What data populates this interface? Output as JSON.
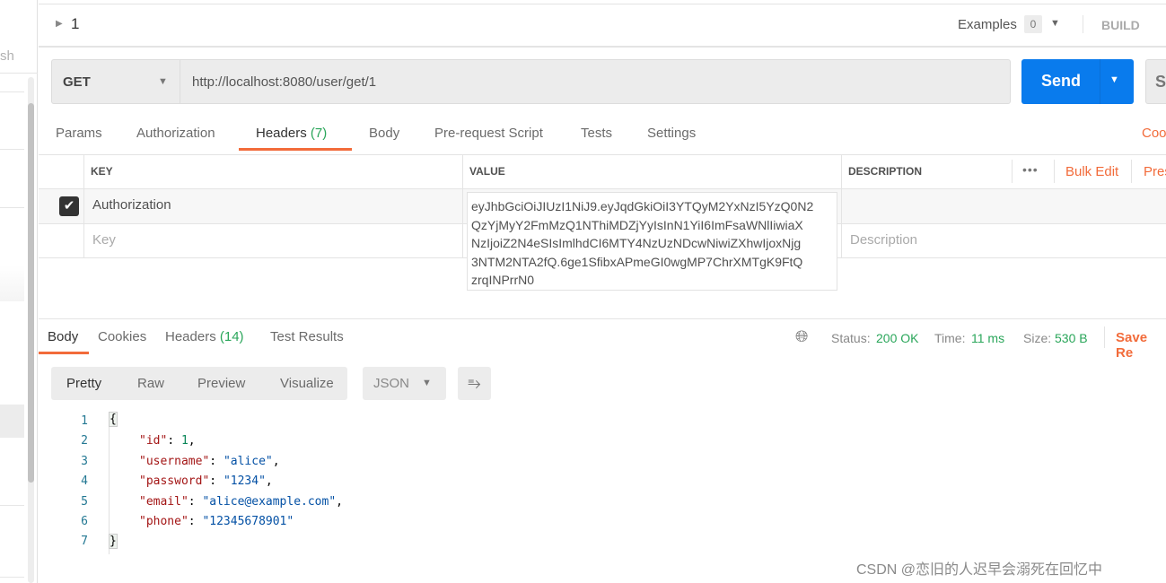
{
  "sidebar": {
    "partial_label": "sh"
  },
  "request": {
    "name": "1",
    "examples_label": "Examples",
    "examples_count": "0",
    "build_label": "BUILD",
    "method": "GET",
    "url": "http://localhost:8080/user/get/1",
    "send_label": "Send",
    "save_label": "Sa",
    "tabs": [
      {
        "label": "Params"
      },
      {
        "label": "Authorization"
      },
      {
        "label": "Headers",
        "count": "(7)"
      },
      {
        "label": "Body"
      },
      {
        "label": "Pre-request Script"
      },
      {
        "label": "Tests"
      },
      {
        "label": "Settings"
      }
    ],
    "cookies_link": "Coo",
    "active_tab": "Headers"
  },
  "headers_table": {
    "columns": {
      "key": "KEY",
      "value": "VALUE",
      "description": "DESCRIPTION"
    },
    "more_label": "•••",
    "bulk_edit": "Bulk Edit",
    "presets": "Pres",
    "rows": [
      {
        "checked": true,
        "key": "Authorization",
        "value": "eyJhbGciOiJIUzI1NiJ9.eyJqdGkiOiI3YTQyM2YxNzI5YzQ0N2QzYjMyY2FmMzQ1NThiMDZjYyIsInN1YiI6ImFsaWNlIiwiaXNzIjoiZ2N4eSIsImlhdCI6MTY4NzUzNDcwNiwiZXhwIjoxNjg3NTM2NTA2fQ.6ge1SfibxAPmeGI0wgMP7ChrXMTgK9FtQzrqINPrrN0"
      }
    ],
    "placeholder": {
      "key": "Key",
      "description": "Description"
    },
    "value_popup_lines": [
      "eyJhbGciOiJIUzI1NiJ9.eyJqdGkiOiI3YTQyM2YxNzI5YzQ0N2",
      "QzYjMyY2FmMzQ1NThiMDZjYyIsInN1YiI6ImFsaWNlIiwiaX",
      "NzIjoiZ2N4eSIsImlhdCI6MTY4NzUzNDcwNiwiZXhwIjoxNjg",
      "3NTM2NTA2fQ.6ge1SfibxAPmeGI0wgMP7ChrXMTgK9FtQ",
      "zrqINPrrN0"
    ]
  },
  "response": {
    "tabs": [
      {
        "label": "Body"
      },
      {
        "label": "Cookies"
      },
      {
        "label": "Headers",
        "count": "(14)"
      },
      {
        "label": "Test Results"
      }
    ],
    "status_label": "Status:",
    "status": "200 OK",
    "time_label": "Time:",
    "time": "11 ms",
    "size_label": "Size:",
    "size": "530 B",
    "save_label": "Save Re",
    "view_modes": [
      "Pretty",
      "Raw",
      "Preview",
      "Visualize"
    ],
    "format": "JSON",
    "lines": [
      "1",
      "2",
      "3",
      "4",
      "5",
      "6",
      "7"
    ],
    "json": {
      "id": "1",
      "username": "\"alice\"",
      "password": "\"1234\"",
      "email": "\"alice@example.com\"",
      "phone": "\"12345678901\""
    }
  },
  "watermark": "CSDN @恋旧的人迟早会溺死在回忆中",
  "colors": {
    "accent": "#f26b3a",
    "send": "#097bed",
    "success": "#2aa65a"
  }
}
